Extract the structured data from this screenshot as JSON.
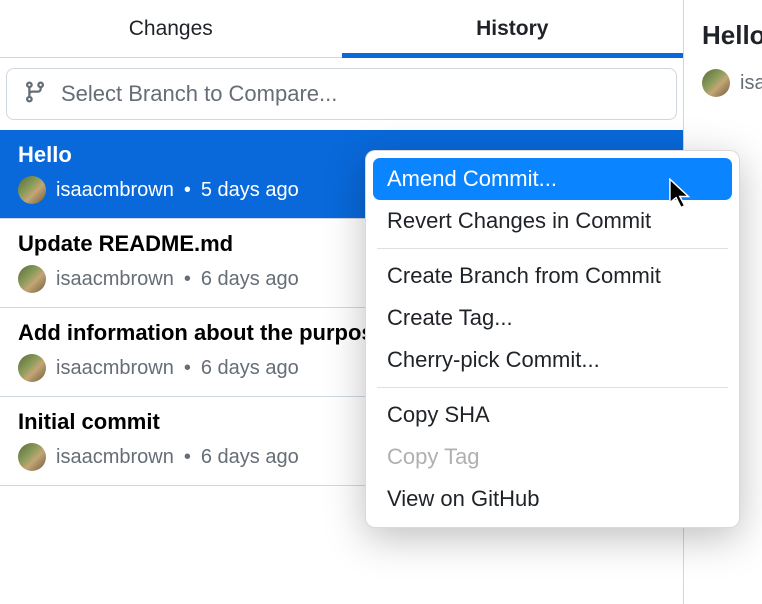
{
  "tabs": {
    "changes": "Changes",
    "history": "History"
  },
  "branchSelector": {
    "placeholder": "Select Branch to Compare..."
  },
  "commits": [
    {
      "title": "Hello",
      "author": "isaacmbrown",
      "time": "5 days ago",
      "selected": true
    },
    {
      "title": "Update README.md",
      "author": "isaacmbrown",
      "time": "6 days ago",
      "selected": false
    },
    {
      "title": "Add information about the purpose",
      "author": "isaacmbrown",
      "time": "6 days ago",
      "selected": false
    },
    {
      "title": "Initial commit",
      "author": "isaacmbrown",
      "time": "6 days ago",
      "selected": false
    }
  ],
  "rightPanel": {
    "title": "Hello",
    "author": "isaacmbrown"
  },
  "contextMenu": {
    "items": [
      {
        "label": "Amend Commit...",
        "highlighted": true,
        "disabled": false
      },
      {
        "label": "Revert Changes in Commit",
        "highlighted": false,
        "disabled": false
      },
      {
        "separator": true
      },
      {
        "label": "Create Branch from Commit",
        "highlighted": false,
        "disabled": false
      },
      {
        "label": "Create Tag...",
        "highlighted": false,
        "disabled": false
      },
      {
        "label": "Cherry-pick Commit...",
        "highlighted": false,
        "disabled": false
      },
      {
        "separator": true
      },
      {
        "label": "Copy SHA",
        "highlighted": false,
        "disabled": false
      },
      {
        "label": "Copy Tag",
        "highlighted": false,
        "disabled": true
      },
      {
        "label": "View on GitHub",
        "highlighted": false,
        "disabled": false
      }
    ]
  }
}
